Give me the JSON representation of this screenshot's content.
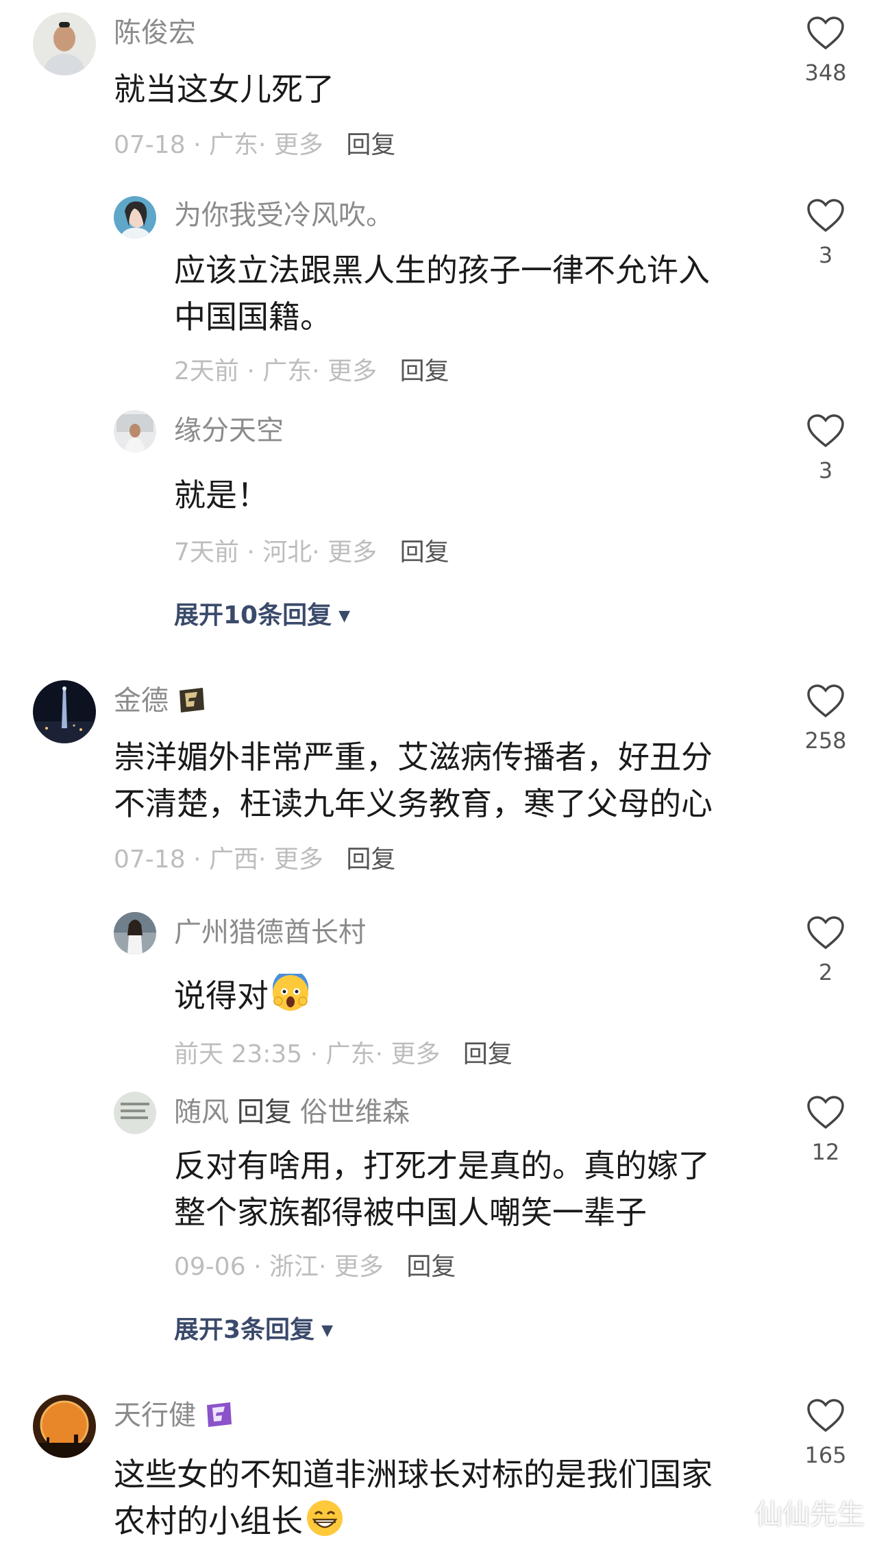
{
  "comments": [
    {
      "user": "陈俊宏",
      "lines": [
        "就当这女儿死了"
      ],
      "date": "07-18",
      "location": "广东",
      "more": "更多",
      "reply_label": "回复",
      "likes": "348",
      "replies": [
        {
          "user": "为你我受冷风吹。",
          "lines": [
            "应该立法跟黑人生的孩子一律不允许入",
            "中国国籍。"
          ],
          "date": "2天前",
          "location": "广东",
          "more": "更多",
          "reply_label": "回复",
          "likes": "3"
        },
        {
          "user": "缘分天空",
          "lines": [
            "就是！"
          ],
          "date": "7天前",
          "location": "河北",
          "more": "更多",
          "reply_label": "回复",
          "likes": "3"
        }
      ],
      "expand": "展开10条回复"
    },
    {
      "user": "金德",
      "lines": [
        "崇洋媚外非常严重，艾滋病传播者，好丑分",
        "不清楚，枉读九年义务教育，寒了父母的心"
      ],
      "date": "07-18",
      "location": "广西",
      "more": "更多",
      "reply_label": "回复",
      "likes": "258",
      "replies": [
        {
          "user": "广州猎德酋长村",
          "lines": [
            "说得对"
          ],
          "date": "前天 23:35",
          "location": "广东",
          "more": "更多",
          "reply_label": "回复",
          "likes": "2"
        },
        {
          "user": "随风",
          "reply_to_label": "回复",
          "reply_to": "俗世维森",
          "lines": [
            "反对有啥用，打死才是真的。真的嫁了",
            "整个家族都得被中国人嘲笑一辈子"
          ],
          "date": "09-06",
          "location": "浙江",
          "more": "更多",
          "reply_label": "回复",
          "likes": "12"
        }
      ],
      "expand": "展开3条回复"
    },
    {
      "user": "天行健",
      "lines": [
        "这些女的不知道非洲球长对标的是我们国家",
        "农村的小组长"
      ],
      "likes": "165"
    }
  ],
  "watermark": "仙仙先生",
  "colors": {
    "username": "#8b8b8b",
    "text": "#1a1a1a",
    "meta": "#bdbdbd",
    "expand": "#3a4a6b"
  }
}
